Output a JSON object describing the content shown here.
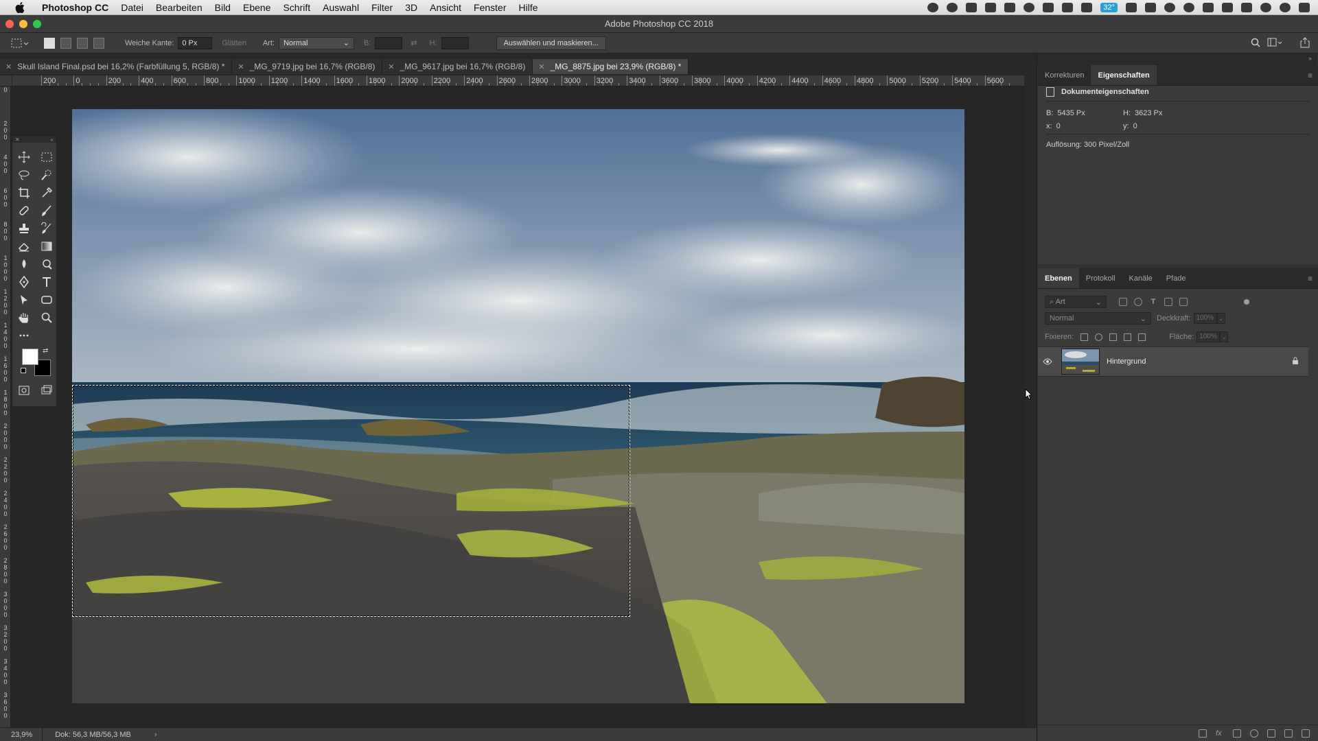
{
  "menubar": {
    "app_name": "Photoshop CC",
    "items": [
      "Datei",
      "Bearbeiten",
      "Bild",
      "Ebene",
      "Schrift",
      "Auswahl",
      "Filter",
      "3D",
      "Ansicht",
      "Fenster",
      "Hilfe"
    ],
    "temperature": "32°"
  },
  "window": {
    "title": "Adobe Photoshop CC 2018"
  },
  "options": {
    "feather_label": "Weiche Kante:",
    "feather_value": "0 Px",
    "antialias_label": "Glätten",
    "style_label": "Art:",
    "style_value": "Normal",
    "width_label": "B:",
    "height_label": "H:",
    "select_mask_button": "Auswählen und maskieren..."
  },
  "tabs": [
    {
      "label": "Skull Island Final.psd bei 16,2% (Farbfüllung 5, RGB/8) *",
      "active": false
    },
    {
      "label": "_MG_9719.jpg bei 16,7% (RGB/8)",
      "active": false
    },
    {
      "label": "_MG_9617.jpg bei 16,7% (RGB/8)",
      "active": false
    },
    {
      "label": "_MG_8875.jpg bei 23,9% (RGB/8) *",
      "active": true
    }
  ],
  "ruler": {
    "h_labels": [
      "200",
      "0",
      "200",
      "400",
      "600",
      "800",
      "1000",
      "1200",
      "1400",
      "1600",
      "1800",
      "2000",
      "2200",
      "2400",
      "2600",
      "2800",
      "3000",
      "3200",
      "3400",
      "3600",
      "3800",
      "4000",
      "4200",
      "4400",
      "4600",
      "4800",
      "5000",
      "5200",
      "5400",
      "5600"
    ],
    "v_labels": [
      "0",
      "2 0 0",
      "4 0 0",
      "6 0 0",
      "8 0 0",
      "1 0 0 0",
      "1 2 0 0",
      "1 4 0 0",
      "1 6 0 0",
      "1 8 0 0",
      "2 0 0 0",
      "2 2 0 0",
      "2 4 0 0",
      "2 6 0 0",
      "2 8 0 0",
      "3 0 0 0",
      "3 2 0 0",
      "3 4 0 0",
      "3 6 0 0"
    ]
  },
  "status": {
    "zoom": "23,9%",
    "doc": "Dok: 56,3 MB/56,3 MB"
  },
  "properties": {
    "tabs": [
      "Korrekturen",
      "Eigenschaften"
    ],
    "active_tab": "Eigenschaften",
    "header": "Dokumenteigenschaften",
    "width_label": "B:",
    "width_value": "5435 Px",
    "height_label": "H:",
    "height_value": "3623 Px",
    "x_label": "x:",
    "x_value": "0",
    "y_label": "y:",
    "y_value": "0",
    "resolution": "Auflösung: 300 Pixel/Zoll"
  },
  "layers": {
    "tabs": [
      "Ebenen",
      "Protokoll",
      "Kanäle",
      "Pfade"
    ],
    "filter_placeholder": "Art",
    "blend_mode": "Normal",
    "opacity_label": "Deckkraft:",
    "opacity_value": "100%",
    "lock_label": "Fixieren:",
    "fill_label": "Fläche:",
    "fill_value": "100%",
    "items": [
      {
        "name": "Hintergrund"
      }
    ]
  },
  "colors": {
    "accent": "#2a9fd6",
    "traffic_close": "#fc605c",
    "traffic_min": "#fdbc40",
    "traffic_max": "#34c84a",
    "foreground": "#ffffff",
    "background": "#000000"
  }
}
